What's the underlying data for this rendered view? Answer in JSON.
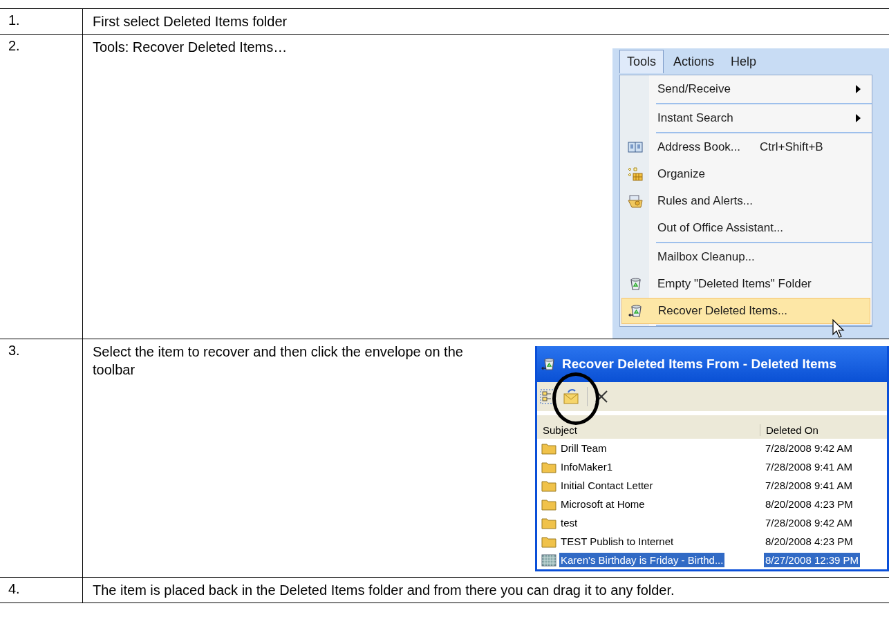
{
  "steps": [
    {
      "number": "1.",
      "text": "First select Deleted Items folder"
    },
    {
      "number": "2.",
      "text": "Tools: Recover Deleted Items…",
      "figure": {
        "kind": "menu",
        "menubar": [
          {
            "label": "Tools",
            "selected": true
          },
          {
            "label": "Actions",
            "selected": false
          },
          {
            "label": "Help",
            "selected": false
          }
        ],
        "items": [
          {
            "label": "Send/Receive",
            "submenu": true,
            "kind": "plain",
            "highlighted": false,
            "separator_after": true
          },
          {
            "label": "Instant Search",
            "submenu": true,
            "kind": "plain",
            "highlighted": false,
            "separator_after": true
          },
          {
            "label": "Address Book...",
            "shortcut": "Ctrl+Shift+B",
            "submenu": false,
            "kind": "book",
            "highlighted": false,
            "separator_after": false
          },
          {
            "label": "Organize",
            "submenu": false,
            "kind": "organize",
            "highlighted": false,
            "separator_after": false
          },
          {
            "label": "Rules and Alerts...",
            "submenu": false,
            "kind": "rules",
            "highlighted": false,
            "separator_after": false
          },
          {
            "label": "Out of Office Assistant...",
            "submenu": false,
            "kind": "plain",
            "highlighted": false,
            "separator_after": true
          },
          {
            "label": "Mailbox Cleanup...",
            "submenu": false,
            "kind": "plain",
            "highlighted": false,
            "separator_after": false
          },
          {
            "label": "Empty \"Deleted Items\" Folder",
            "submenu": false,
            "kind": "bin",
            "highlighted": false,
            "separator_after": false
          },
          {
            "label": "Recover Deleted Items...",
            "submenu": false,
            "kind": "recover",
            "highlighted": true,
            "separator_after": true
          }
        ]
      }
    },
    {
      "number": "3.",
      "text": "Select the item to recover and then click the envelope on the toolbar",
      "figure": {
        "kind": "window",
        "title": "Recover Deleted Items From -  Deleted Items",
        "columns": [
          "Subject",
          "Deleted On"
        ],
        "rows": [
          {
            "subject": "Drill Team",
            "deleted_on": "7/28/2008 9:42 AM",
            "kind": "folder",
            "selected": false
          },
          {
            "subject": "InfoMaker1",
            "deleted_on": "7/28/2008 9:41 AM",
            "kind": "folder",
            "selected": false
          },
          {
            "subject": "Initial Contact Letter",
            "deleted_on": "7/28/2008 9:41 AM",
            "kind": "folder",
            "selected": false
          },
          {
            "subject": "Microsoft at Home",
            "deleted_on": "8/20/2008 4:23 PM",
            "kind": "folder",
            "selected": false
          },
          {
            "subject": "test",
            "deleted_on": "7/28/2008 9:42 AM",
            "kind": "folder",
            "selected": false
          },
          {
            "subject": "TEST Publish to Internet",
            "deleted_on": "8/20/2008 4:23 PM",
            "kind": "folder",
            "selected": false
          },
          {
            "subject": "Karen's Birthday is Friday - Birthd...",
            "deleted_on": "8/27/2008 12:39 PM",
            "kind": "message",
            "selected": true
          }
        ]
      }
    },
    {
      "number": "4.",
      "text": "The item is placed back in the Deleted Items folder and from there you can drag it to any folder."
    }
  ]
}
